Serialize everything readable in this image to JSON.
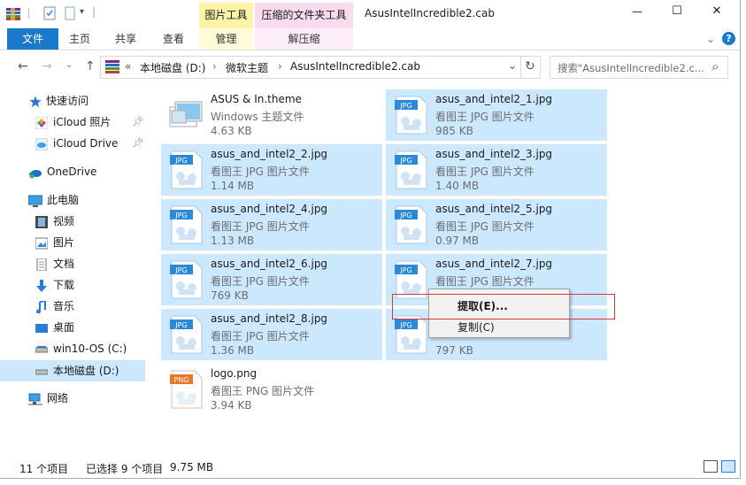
{
  "window": {
    "title": "AsusIntelIncredible2.cab",
    "quick_access_sep": "|",
    "minimize": "—",
    "maximize": "☐",
    "close": "✕"
  },
  "ribbon": {
    "context_tabs": [
      {
        "label": "图片工具",
        "sub": "管理"
      },
      {
        "label": "压缩的文件夹工具",
        "sub": "解压缩"
      }
    ],
    "tabs": [
      "文件",
      "主页",
      "共享",
      "查看"
    ],
    "expand": "⌄",
    "help": "?"
  },
  "address": {
    "prefix": "«",
    "crumbs": [
      "本地磁盘 (D:)",
      "微软主题",
      "AsusIntelIncredible2.cab"
    ],
    "sep": "›",
    "dropdown": "⌄",
    "refresh": "↻",
    "search_placeholder": "搜索\"AsusIntelIncredible2.c...",
    "search_icon": "⌕"
  },
  "nav": {
    "quick_access": "快速访问",
    "icloud_photos": "iCloud 照片",
    "icloud_drive": "iCloud Drive",
    "onedrive": "OneDrive",
    "this_pc": "此电脑",
    "videos": "视频",
    "pictures": "图片",
    "documents": "文档",
    "downloads": "下载",
    "music": "音乐",
    "desktop": "桌面",
    "drive_c": "win10-OS (C:)",
    "drive_d": "本地磁盘 (D:)",
    "network": "网络"
  },
  "files": [
    {
      "name": "ASUS & In.theme",
      "type": "Windows 主题文件",
      "size": "4.63 KB",
      "icon": "theme-icon",
      "selected": false
    },
    {
      "name": "asus_and_intel2_1.jpg",
      "type": "看图王 JPG 图片文件",
      "size": "985 KB",
      "icon": "jpg-file-icon",
      "selected": true
    },
    {
      "name": "asus_and_intel2_2.jpg",
      "type": "看图王 JPG 图片文件",
      "size": "1.14 MB",
      "icon": "jpg-file-icon",
      "selected": true
    },
    {
      "name": "asus_and_intel2_3.jpg",
      "type": "看图王 JPG 图片文件",
      "size": "1.40 MB",
      "icon": "jpg-file-icon",
      "selected": true
    },
    {
      "name": "asus_and_intel2_4.jpg",
      "type": "看图王 JPG 图片文件",
      "size": "1.13 MB",
      "icon": "jpg-file-icon",
      "selected": true
    },
    {
      "name": "asus_and_intel2_5.jpg",
      "type": "看图王 JPG 图片文件",
      "size": "0.97 MB",
      "icon": "jpg-file-icon",
      "selected": true
    },
    {
      "name": "asus_and_intel2_6.jpg",
      "type": "看图王 JPG 图片文件",
      "size": "769 KB",
      "icon": "jpg-file-icon",
      "selected": true
    },
    {
      "name": "asus_and_intel2_7.jpg",
      "type": "看图王 JPG 图片文件",
      "size": "",
      "icon": "jpg-file-icon",
      "selected": true
    },
    {
      "name": "asus_and_intel2_8.jpg",
      "type": "看图王 JPG 图片文件",
      "size": "1.36 MB",
      "icon": "jpg-file-icon",
      "selected": true
    },
    {
      "name": "",
      "type": "",
      "size": "797 KB",
      "icon": "jpg-file-icon",
      "selected": true
    },
    {
      "name": "logo.png",
      "type": "看图王 PNG 图片文件",
      "size": "3.94 KB",
      "icon": "png-file-icon",
      "selected": false
    }
  ],
  "icon_badges": {
    "jpg": "JPG",
    "png": "PNG"
  },
  "context_menu": {
    "extract": "提取(E)...",
    "copy": "复制(C)"
  },
  "status": {
    "count": "11 个项目",
    "selected": "已选择 9 个项目",
    "size": "9.75 MB"
  },
  "colors": {
    "accent": "#1979ca",
    "selection": "#cce8ff",
    "ctx_picture": "#fcf3a6",
    "ctx_zip": "#f8dbef",
    "highlight_box": "#d9383a"
  }
}
